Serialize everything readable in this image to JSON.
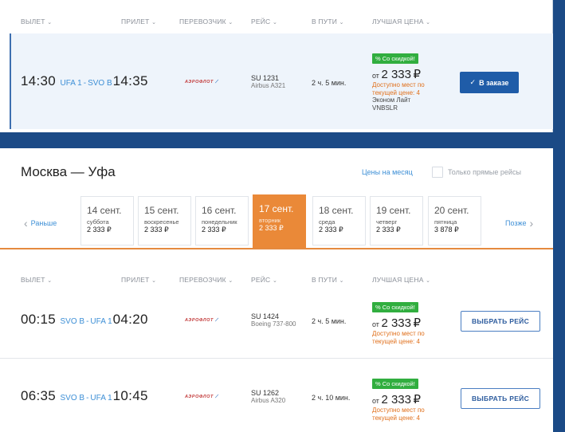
{
  "headers": {
    "depart": "ВЫЛЕТ",
    "arrive": "ПРИЛЕТ",
    "carrier": "ПЕРЕВОЗЧИК",
    "flight": "РЕЙС",
    "duration": "В ПУТИ",
    "price": "ЛУЧШАЯ ЦЕНА",
    "sort_mark": "⌄"
  },
  "selected_flight": {
    "dep_time": "14:30",
    "dep_code": "UFA 1",
    "dash": "-",
    "arr_code": "SVO B",
    "arr_time": "14:35",
    "airline": "АЭРОФЛОТ",
    "flight_no": "SU 1231",
    "aircraft": "Airbus A321",
    "duration": "2 ч. 5 мин.",
    "badge": "% Со скидкой!",
    "price_prefix": "от",
    "price": "2 333",
    "currency": "₽",
    "availability": "Доступно мест по текущей цене: 4",
    "fare": "Эконом Лайт",
    "fare_code": "VNBSLR",
    "button": "В заказе"
  },
  "search": {
    "route_title": "Москва — Уфа",
    "month_prices_link": "Цены на месяц",
    "direct_only_label": "Только прямые рейсы",
    "earlier": "Раньше",
    "later": "Позже"
  },
  "dates": [
    {
      "date": "14 сент.",
      "weekday": "суббота",
      "price": "2 333 ₽"
    },
    {
      "date": "15 сент.",
      "weekday": "воскресенье",
      "price": "2 333 ₽"
    },
    {
      "date": "16 сент.",
      "weekday": "понедельник",
      "price": "2 333 ₽"
    },
    {
      "date": "17 сент.",
      "weekday": "вторник",
      "price": "2 333 ₽"
    },
    {
      "date": "18 сент.",
      "weekday": "среда",
      "price": "2 333 ₽"
    },
    {
      "date": "19 сент.",
      "weekday": "четверг",
      "price": "2 333 ₽"
    },
    {
      "date": "20 сент.",
      "weekday": "пятница",
      "price": "3 878 ₽"
    }
  ],
  "flights": [
    {
      "dep_time": "00:15",
      "dep_code": "SVO B",
      "dash": "-",
      "arr_code": "UFA 1",
      "arr_time": "04:20",
      "airline": "АЭРОФЛОТ",
      "flight_no": "SU 1424",
      "aircraft": "Boeing 737-800",
      "duration": "2 ч. 5 мин.",
      "badge": "% Со скидкой!",
      "price_prefix": "от",
      "price": "2 333",
      "currency": "₽",
      "availability": "Доступно мест по текущей цене: 4",
      "button": "ВЫБРАТЬ РЕЙС"
    },
    {
      "dep_time": "06:35",
      "dep_code": "SVO B",
      "dash": "-",
      "arr_code": "UFA 1",
      "arr_time": "10:45",
      "airline": "АЭРОФЛОТ",
      "flight_no": "SU 1262",
      "aircraft": "Airbus A320",
      "duration": "2 ч. 10 мин.",
      "badge": "% Со скидкой!",
      "price_prefix": "от",
      "price": "2 333",
      "currency": "₽",
      "availability": "Доступно мест по текущей цене: 4",
      "button": "ВЫБРАТЬ РЕЙС"
    }
  ]
}
